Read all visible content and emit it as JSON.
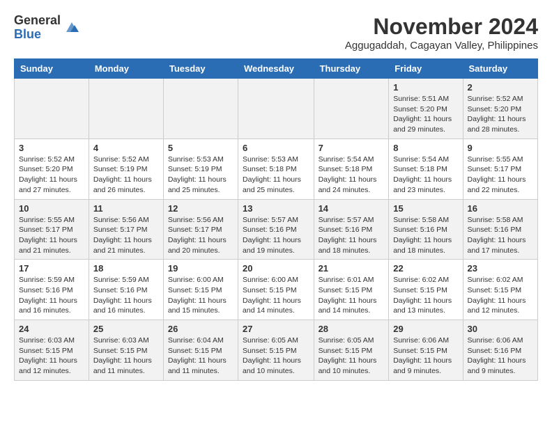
{
  "logo": {
    "general": "General",
    "blue": "Blue"
  },
  "title": "November 2024",
  "location": "Aggugaddah, Cagayan Valley, Philippines",
  "days_of_week": [
    "Sunday",
    "Monday",
    "Tuesday",
    "Wednesday",
    "Thursday",
    "Friday",
    "Saturday"
  ],
  "weeks": [
    [
      {
        "day": "",
        "info": ""
      },
      {
        "day": "",
        "info": ""
      },
      {
        "day": "",
        "info": ""
      },
      {
        "day": "",
        "info": ""
      },
      {
        "day": "",
        "info": ""
      },
      {
        "day": "1",
        "info": "Sunrise: 5:51 AM\nSunset: 5:20 PM\nDaylight: 11 hours and 29 minutes."
      },
      {
        "day": "2",
        "info": "Sunrise: 5:52 AM\nSunset: 5:20 PM\nDaylight: 11 hours and 28 minutes."
      }
    ],
    [
      {
        "day": "3",
        "info": "Sunrise: 5:52 AM\nSunset: 5:20 PM\nDaylight: 11 hours and 27 minutes."
      },
      {
        "day": "4",
        "info": "Sunrise: 5:52 AM\nSunset: 5:19 PM\nDaylight: 11 hours and 26 minutes."
      },
      {
        "day": "5",
        "info": "Sunrise: 5:53 AM\nSunset: 5:19 PM\nDaylight: 11 hours and 25 minutes."
      },
      {
        "day": "6",
        "info": "Sunrise: 5:53 AM\nSunset: 5:18 PM\nDaylight: 11 hours and 25 minutes."
      },
      {
        "day": "7",
        "info": "Sunrise: 5:54 AM\nSunset: 5:18 PM\nDaylight: 11 hours and 24 minutes."
      },
      {
        "day": "8",
        "info": "Sunrise: 5:54 AM\nSunset: 5:18 PM\nDaylight: 11 hours and 23 minutes."
      },
      {
        "day": "9",
        "info": "Sunrise: 5:55 AM\nSunset: 5:17 PM\nDaylight: 11 hours and 22 minutes."
      }
    ],
    [
      {
        "day": "10",
        "info": "Sunrise: 5:55 AM\nSunset: 5:17 PM\nDaylight: 11 hours and 21 minutes."
      },
      {
        "day": "11",
        "info": "Sunrise: 5:56 AM\nSunset: 5:17 PM\nDaylight: 11 hours and 21 minutes."
      },
      {
        "day": "12",
        "info": "Sunrise: 5:56 AM\nSunset: 5:17 PM\nDaylight: 11 hours and 20 minutes."
      },
      {
        "day": "13",
        "info": "Sunrise: 5:57 AM\nSunset: 5:16 PM\nDaylight: 11 hours and 19 minutes."
      },
      {
        "day": "14",
        "info": "Sunrise: 5:57 AM\nSunset: 5:16 PM\nDaylight: 11 hours and 18 minutes."
      },
      {
        "day": "15",
        "info": "Sunrise: 5:58 AM\nSunset: 5:16 PM\nDaylight: 11 hours and 18 minutes."
      },
      {
        "day": "16",
        "info": "Sunrise: 5:58 AM\nSunset: 5:16 PM\nDaylight: 11 hours and 17 minutes."
      }
    ],
    [
      {
        "day": "17",
        "info": "Sunrise: 5:59 AM\nSunset: 5:16 PM\nDaylight: 11 hours and 16 minutes."
      },
      {
        "day": "18",
        "info": "Sunrise: 5:59 AM\nSunset: 5:16 PM\nDaylight: 11 hours and 16 minutes."
      },
      {
        "day": "19",
        "info": "Sunrise: 6:00 AM\nSunset: 5:15 PM\nDaylight: 11 hours and 15 minutes."
      },
      {
        "day": "20",
        "info": "Sunrise: 6:00 AM\nSunset: 5:15 PM\nDaylight: 11 hours and 14 minutes."
      },
      {
        "day": "21",
        "info": "Sunrise: 6:01 AM\nSunset: 5:15 PM\nDaylight: 11 hours and 14 minutes."
      },
      {
        "day": "22",
        "info": "Sunrise: 6:02 AM\nSunset: 5:15 PM\nDaylight: 11 hours and 13 minutes."
      },
      {
        "day": "23",
        "info": "Sunrise: 6:02 AM\nSunset: 5:15 PM\nDaylight: 11 hours and 12 minutes."
      }
    ],
    [
      {
        "day": "24",
        "info": "Sunrise: 6:03 AM\nSunset: 5:15 PM\nDaylight: 11 hours and 12 minutes."
      },
      {
        "day": "25",
        "info": "Sunrise: 6:03 AM\nSunset: 5:15 PM\nDaylight: 11 hours and 11 minutes."
      },
      {
        "day": "26",
        "info": "Sunrise: 6:04 AM\nSunset: 5:15 PM\nDaylight: 11 hours and 11 minutes."
      },
      {
        "day": "27",
        "info": "Sunrise: 6:05 AM\nSunset: 5:15 PM\nDaylight: 11 hours and 10 minutes."
      },
      {
        "day": "28",
        "info": "Sunrise: 6:05 AM\nSunset: 5:15 PM\nDaylight: 11 hours and 10 minutes."
      },
      {
        "day": "29",
        "info": "Sunrise: 6:06 AM\nSunset: 5:15 PM\nDaylight: 11 hours and 9 minutes."
      },
      {
        "day": "30",
        "info": "Sunrise: 6:06 AM\nSunset: 5:16 PM\nDaylight: 11 hours and 9 minutes."
      }
    ]
  ]
}
